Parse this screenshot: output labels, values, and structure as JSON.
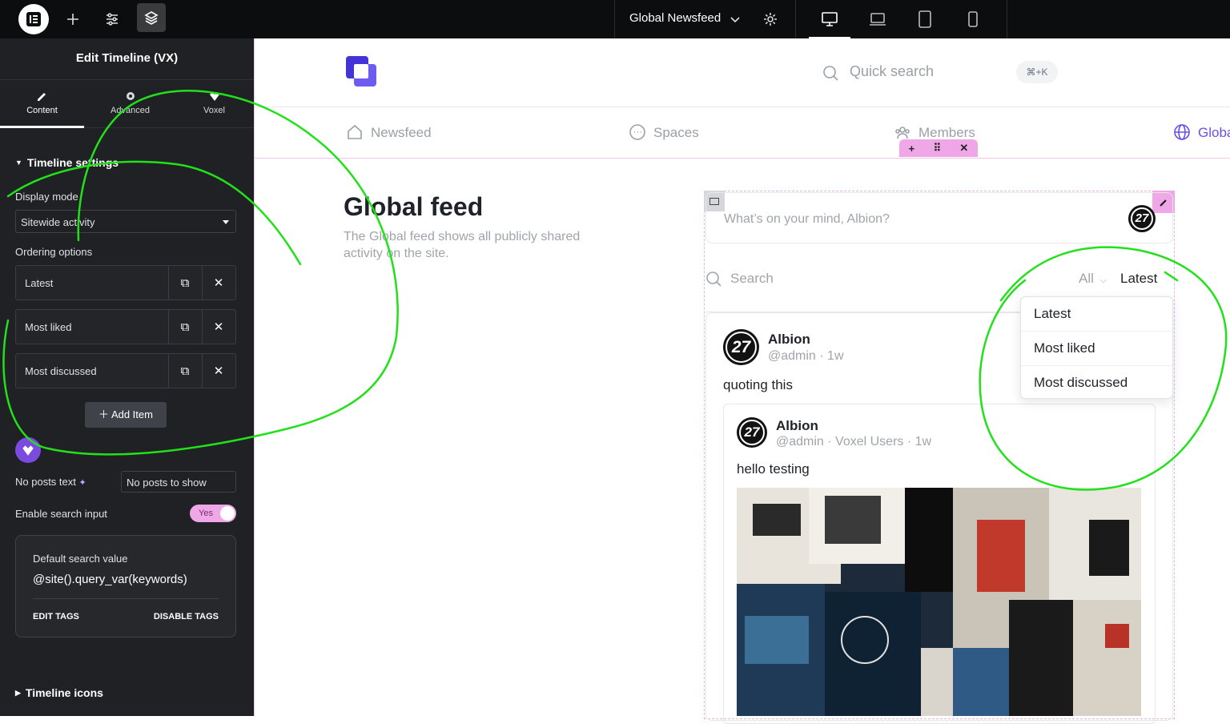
{
  "topbar": {
    "page_title": "Global Newsfeed",
    "icons": [
      "elementor-logo-icon",
      "add-icon",
      "settings-sliders-icon",
      "layers-icon",
      "chevron-down-icon",
      "gear-icon",
      "desktop-icon",
      "laptop-icon",
      "tablet-icon",
      "mobile-icon"
    ]
  },
  "panel": {
    "title": "Edit Timeline (VX)",
    "tabs": [
      {
        "label": "Content",
        "icon": "pencil-icon"
      },
      {
        "label": "Advanced",
        "icon": "gear-icon"
      },
      {
        "label": "Voxel",
        "icon": "voxel-heart-icon"
      }
    ],
    "section_timeline_settings": "Timeline settings",
    "display_mode_label": "Display mode",
    "display_mode_value": "Sitewide activity",
    "ordering_label": "Ordering options",
    "ordering_items": [
      "Latest",
      "Most liked",
      "Most discussed"
    ],
    "add_item_label": "Add Item",
    "no_posts_label": "No posts text",
    "no_posts_value": "No posts to show",
    "enable_search_label": "Enable search input",
    "enable_search_toggle": "Yes",
    "default_search_label": "Default search value",
    "default_search_value": "@site().query_var(keywords)",
    "edit_tags": "EDIT TAGS",
    "disable_tags": "DISABLE TAGS",
    "section_timeline_icons": "Timeline icons"
  },
  "site": {
    "quick_search_placeholder": "Quick search",
    "quick_search_shortcut": "⌘+K",
    "nav": [
      "Newsfeed",
      "Spaces",
      "Members",
      "Global"
    ],
    "feed_title": "Global feed",
    "feed_desc": "The Global feed shows all publicly shared activity on the site.",
    "composer_placeholder": "What’s on your mind, Albion?",
    "avatar_text": "27",
    "search_placeholder": "Search",
    "filter_all": "All",
    "filter_order": "Latest",
    "dropdown": [
      "Latest",
      "Most liked",
      "Most discussed"
    ],
    "post": {
      "author": "Albion",
      "meta": "@admin · 1w",
      "text": "quoting this",
      "quoted": {
        "author": "Albion",
        "meta": "@admin · Voxel Users · 1w",
        "text": "hello testing"
      }
    }
  },
  "colors": {
    "accent_purple": "#6d4ee6",
    "editor_pink": "#f0a7e8",
    "annotation_green": "#22e01a"
  }
}
